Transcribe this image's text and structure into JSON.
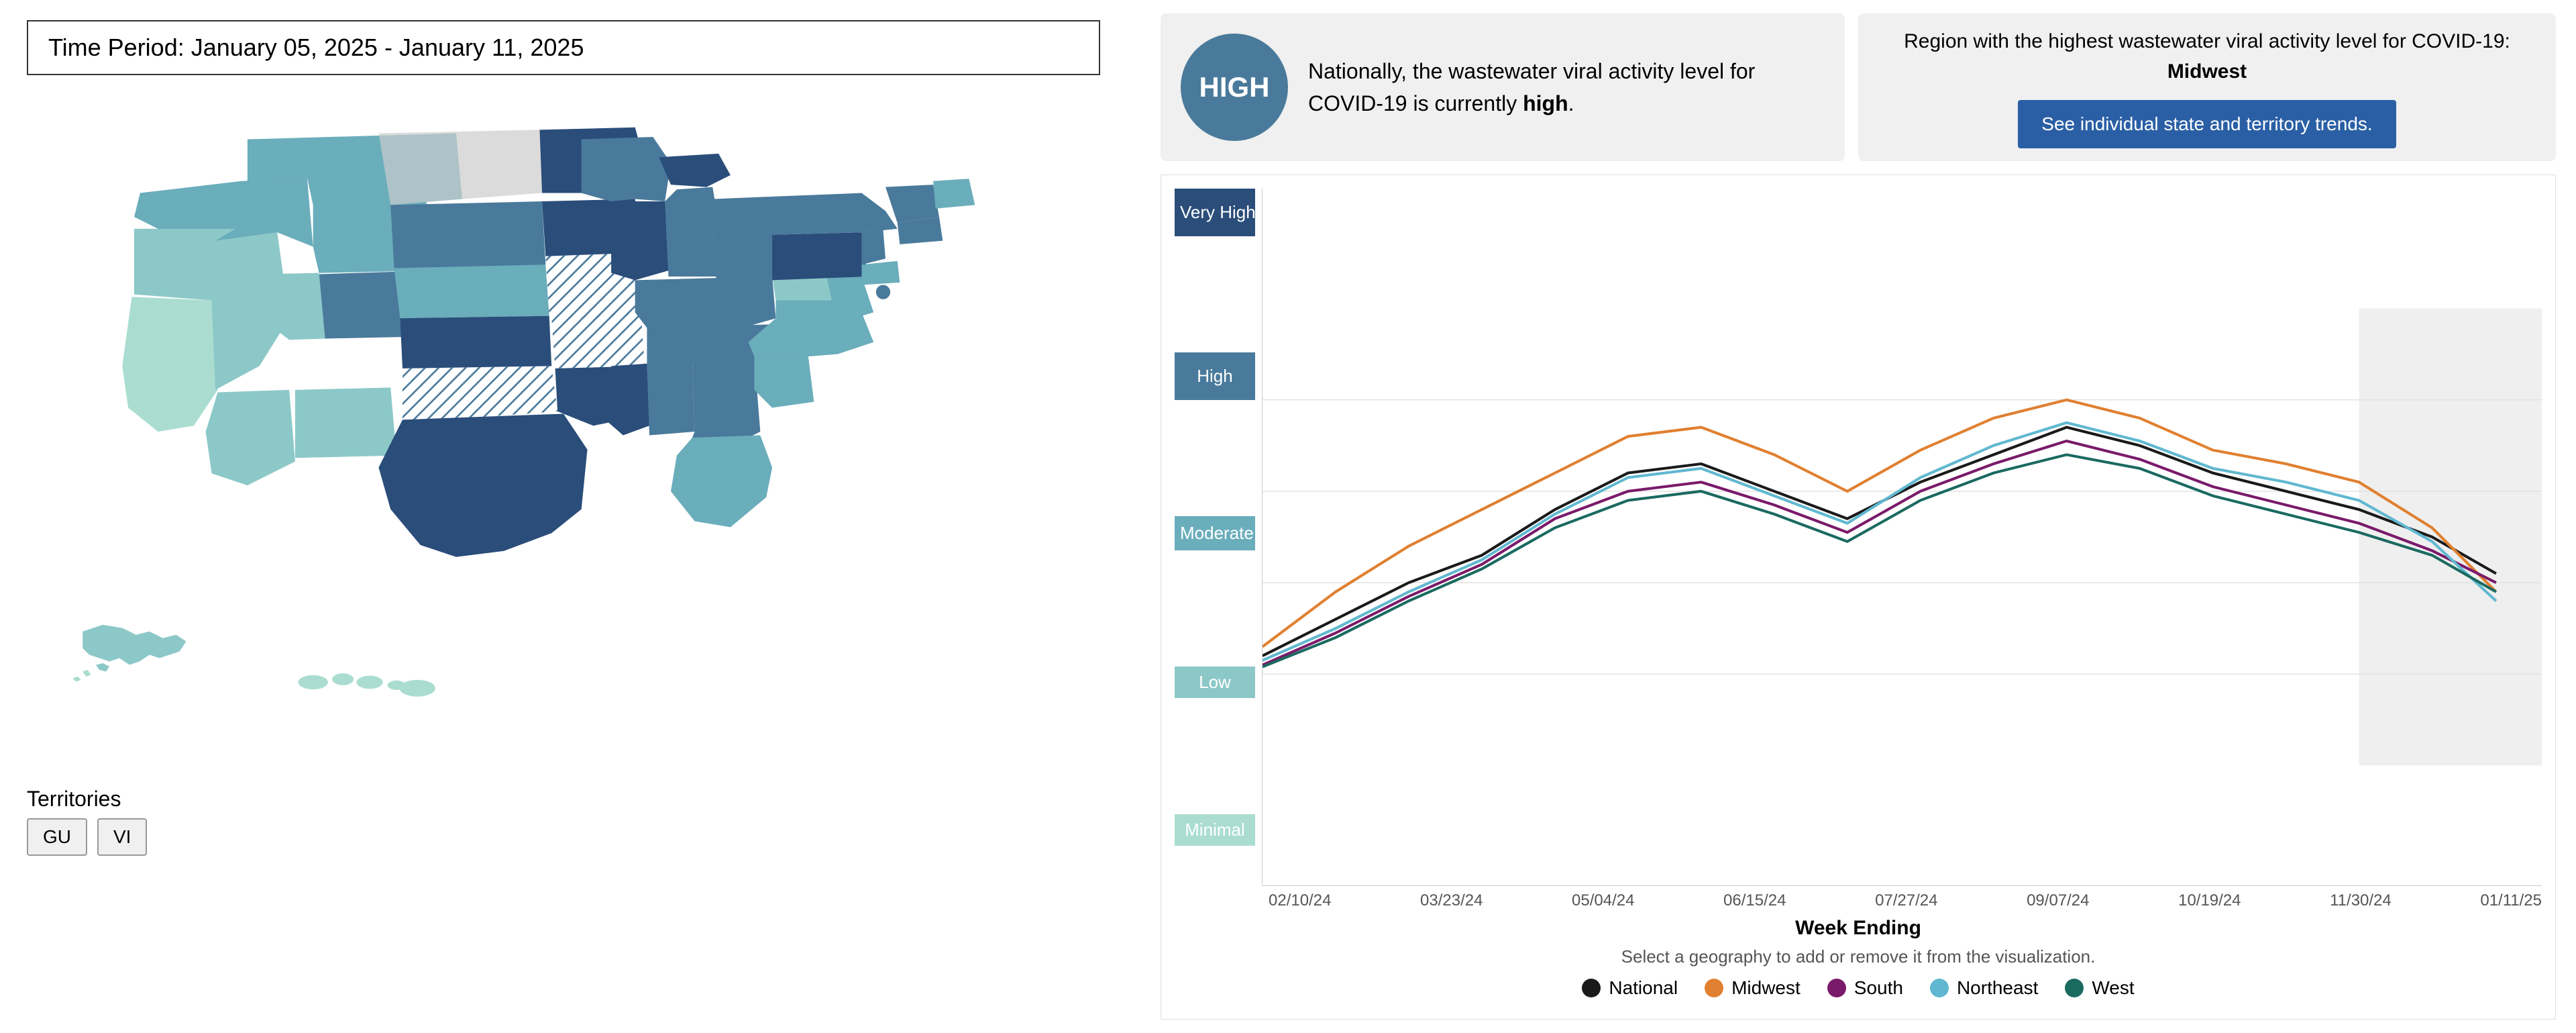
{
  "header": {
    "time_period_label": "Time Period: January 05, 2025 - January 11, 2025"
  },
  "national_card": {
    "level": "HIGH",
    "description_prefix": "Nationally, the wastewater viral activity level for COVID-19 is currently ",
    "level_text": "high",
    "description_suffix": "."
  },
  "region_card": {
    "label": "Region with the highest wastewater viral activity level for COVID-19:",
    "region_name": "Midwest",
    "button_label": "See individual state and territory trends."
  },
  "chart": {
    "y_labels": {
      "very_high": "Very High",
      "high": "High",
      "moderate": "Moderate",
      "low": "Low",
      "minimal": "Minimal"
    },
    "x_labels": [
      "02/10/24",
      "03/23/24",
      "05/04/24",
      "06/15/24",
      "07/27/24",
      "09/07/24",
      "10/19/24",
      "11/30/24",
      "01/11/25"
    ],
    "week_ending": "Week Ending",
    "select_geography": "Select a geography to add or remove it from the visualization."
  },
  "legend": {
    "items": [
      {
        "name": "National",
        "color": "#1a1a1a"
      },
      {
        "name": "Midwest",
        "color": "#e08030"
      },
      {
        "name": "South",
        "color": "#7a1a6a"
      },
      {
        "name": "Northeast",
        "color": "#60b8d0"
      },
      {
        "name": "West",
        "color": "#1a6a60"
      }
    ]
  },
  "territories": {
    "label": "Territories",
    "buttons": [
      "GU",
      "VI"
    ]
  }
}
